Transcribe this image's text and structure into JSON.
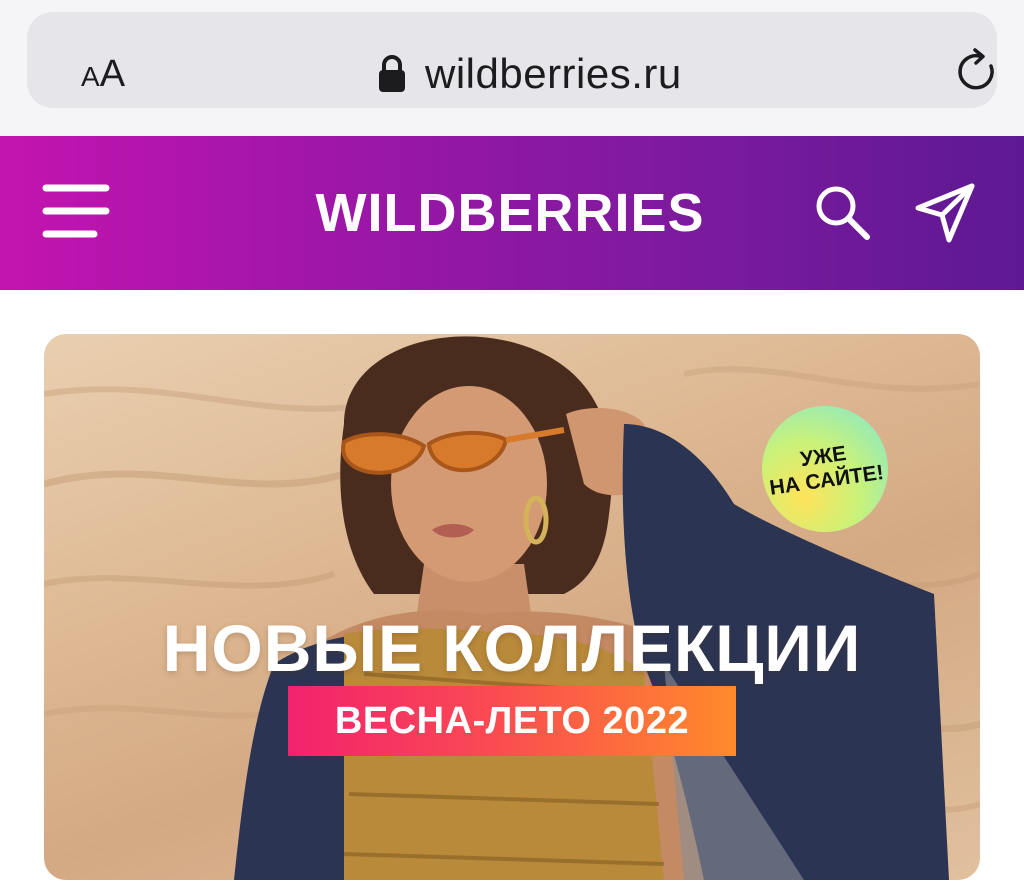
{
  "browser": {
    "text_size_small": "A",
    "text_size_big": "A",
    "url": "wildberries.ru",
    "icons": [
      "lock-icon",
      "reload-icon"
    ]
  },
  "header": {
    "logo": "WILDBERRIES",
    "icons": [
      "menu-icon",
      "search-icon",
      "send-icon"
    ],
    "gradient": [
      "#c414b0",
      "#5e1992"
    ]
  },
  "banner": {
    "badge_line1": "УЖЕ",
    "badge_line2": "НА САЙТЕ!",
    "headline": "НОВЫЕ КОЛЛЕКЦИИ",
    "season": "ВЕСНА-ЛЕТО 2022",
    "season_gradient": [
      "#f2226e",
      "#ff8a2a"
    ],
    "badge_gradient": [
      "#ffe35a",
      "#7fe6d4"
    ]
  }
}
